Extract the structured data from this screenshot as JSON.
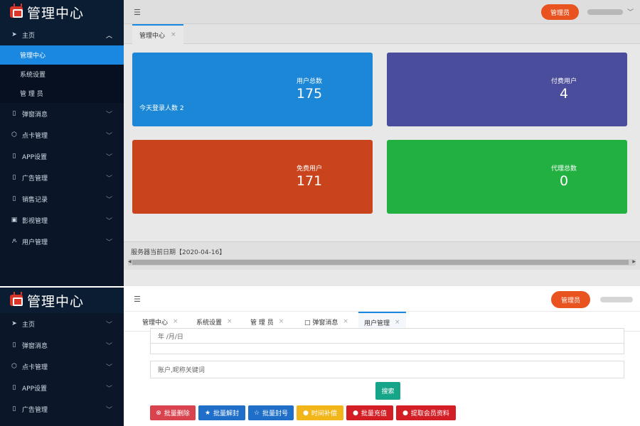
{
  "brand": {
    "title": "管理中心"
  },
  "screen1": {
    "sidebar": {
      "home": "主页",
      "sub_items": [
        "管理中心",
        "系统设置",
        "管 理 员"
      ],
      "items": [
        {
          "icon": "phone-icon",
          "label": "弹窗消息"
        },
        {
          "icon": "cube-icon",
          "label": "点卡管理"
        },
        {
          "icon": "phone-icon",
          "label": "APP设置"
        },
        {
          "icon": "phone-icon",
          "label": "广告管理"
        },
        {
          "icon": "phone-icon",
          "label": "销售记录"
        },
        {
          "icon": "video-icon",
          "label": "影视管理"
        },
        {
          "icon": "user-icon",
          "label": "用户管理"
        }
      ]
    },
    "header": {
      "admin_label": "管理员"
    },
    "tabs": [
      "管理中心"
    ],
    "cards": [
      {
        "label": "用户总数",
        "value": "175",
        "note": "今天登录人数 2",
        "color": "#1c87d6"
      },
      {
        "label": "付费用户",
        "value": "4",
        "note": "",
        "color": "#4a4d9c"
      },
      {
        "label": "免费用户",
        "value": "171",
        "note": "",
        "color": "#c9441c"
      },
      {
        "label": "代理总数",
        "value": "0",
        "note": "",
        "color": "#22b140"
      }
    ],
    "footer": {
      "server_date": "服务器当前日期【2020-04-16】"
    }
  },
  "screen2": {
    "sidebar": {
      "items": [
        {
          "icon": "send-icon",
          "label": "主页"
        },
        {
          "icon": "phone-icon",
          "label": "弹窗消息"
        },
        {
          "icon": "cube-icon",
          "label": "点卡管理"
        },
        {
          "icon": "phone-icon",
          "label": "APP设置"
        },
        {
          "icon": "phone-icon",
          "label": "广告管理"
        }
      ]
    },
    "header": {
      "admin_label": "管理员"
    },
    "tabs": [
      {
        "label": "管理中心"
      },
      {
        "label": "系统设置"
      },
      {
        "label": "管 理 员"
      },
      {
        "label": "□ 弹窗消息"
      },
      {
        "label": "用户管理"
      }
    ],
    "form": {
      "date_placeholder": "年 /月/日",
      "keyword_placeholder": "账户,昵称关键词",
      "search_label": "搜索"
    },
    "actions": [
      {
        "icon": "ban-icon",
        "glyph": "⊗",
        "label": "批量删除",
        "color": "#d9434e"
      },
      {
        "icon": "star-icon",
        "glyph": "★",
        "label": "批量解封",
        "color": "#1f6fc9"
      },
      {
        "icon": "star-outline-icon",
        "glyph": "☆",
        "label": "批量封号",
        "color": "#1f6fc9"
      },
      {
        "icon": "clock-icon",
        "glyph": "●",
        "label": "时间补偿",
        "color": "#f2b51a"
      },
      {
        "icon": "circle-icon",
        "glyph": "●",
        "label": "批量充值",
        "color": "#d41e26"
      },
      {
        "icon": "circle-icon",
        "glyph": "●",
        "label": "提取会员资料",
        "color": "#d41e26"
      }
    ]
  }
}
